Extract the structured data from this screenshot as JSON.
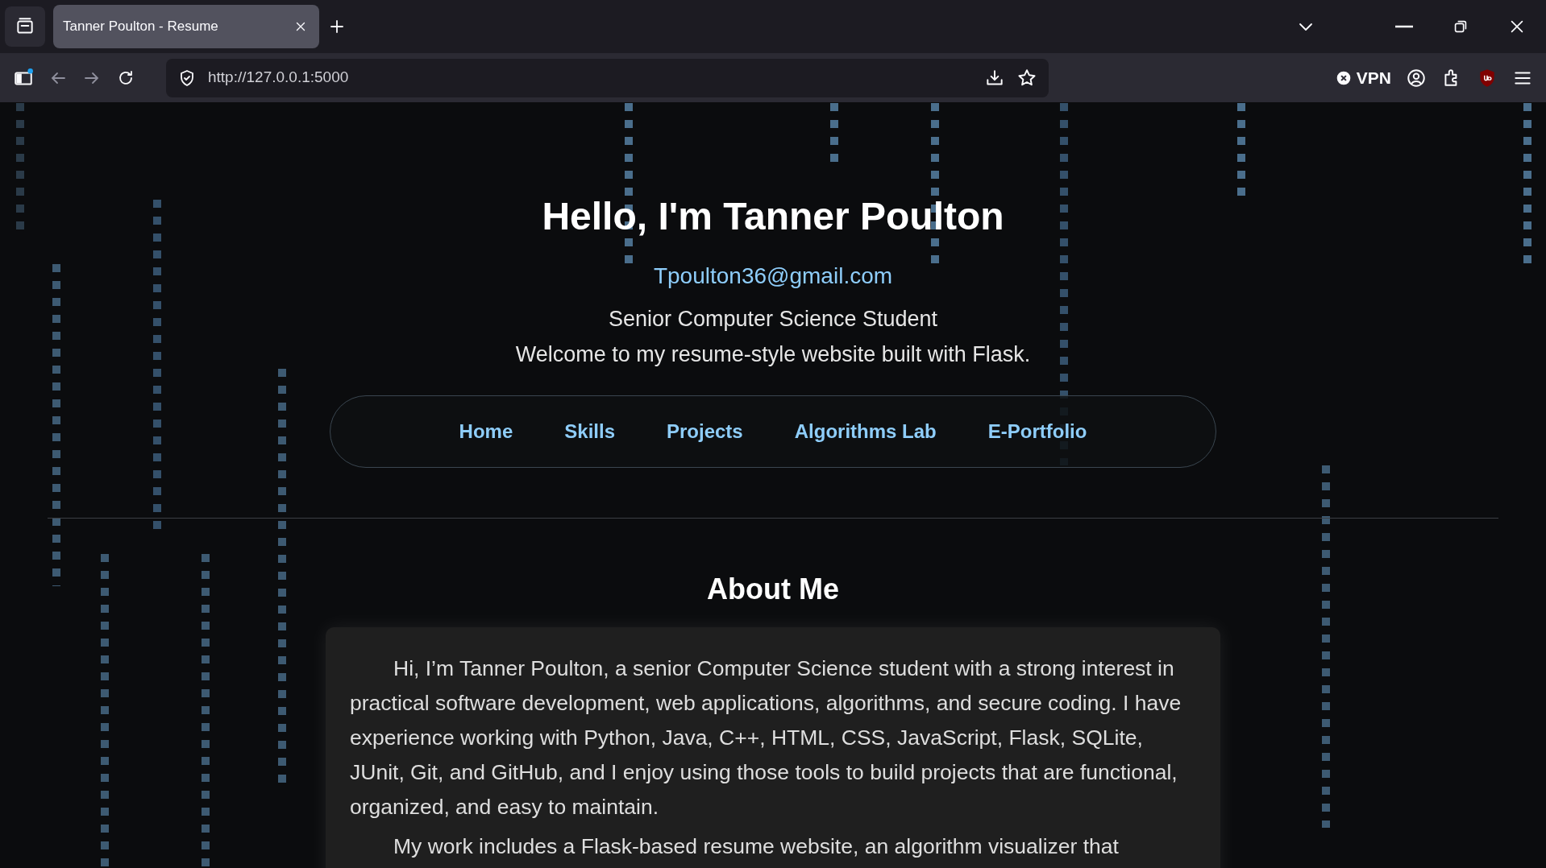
{
  "browser": {
    "tabs": [
      {
        "title": "Tanner Poulton - Resume",
        "selected": true
      }
    ],
    "url": "http://127.0.0.1:5000",
    "vpn_label": "VPN"
  },
  "hero": {
    "title": "Hello, I'm Tanner Poulton",
    "email": "Tpoulton36@gmail.com",
    "subtitle": "Senior Computer Science Student",
    "welcome": "Welcome to my resume-style website built with Flask."
  },
  "nav": [
    {
      "label": "Home"
    },
    {
      "label": "Skills"
    },
    {
      "label": "Projects"
    },
    {
      "label": "Algorithms Lab"
    },
    {
      "label": "E-Portfolio"
    }
  ],
  "about": {
    "heading": "About Me",
    "paragraphs": [
      "Hi, I’m Tanner Poulton, a senior Computer Science student with a strong interest in practical software development, web applications, algorithms, and secure coding. I have experience working with Python, Java, C++, HTML, CSS, JavaScript, Flask, SQLite, JUnit, Git, and GitHub, and I enjoy using those tools to build projects that are functional, organized, and easy to maintain.",
      "My work includes a Flask-based resume website, an algorithm visualizer that"
    ]
  }
}
